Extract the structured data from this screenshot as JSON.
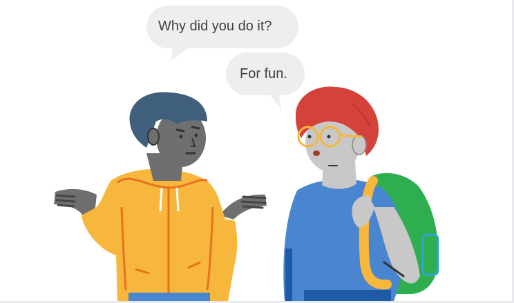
{
  "dialogue": {
    "question": "Why did you do it?",
    "answer": "For fun."
  },
  "colors": {
    "bubble": "#eeeeee",
    "hair_left": "#3f5f7d",
    "hair_right": "#d5423a",
    "skin_left": "#6f6f6f",
    "skin_right": "#c8c8c8",
    "hoodie": "#f6b73c",
    "hoodie_lines": "#e8711c",
    "shirt": "#4a86d0",
    "backpack": "#2fae4f",
    "backpack_trim": "#f6b73c",
    "glasses": "#f6b73c"
  },
  "icons": [
    "person-confused-icon",
    "person-glasses-backpack-icon",
    "speech-bubble-icon"
  ]
}
